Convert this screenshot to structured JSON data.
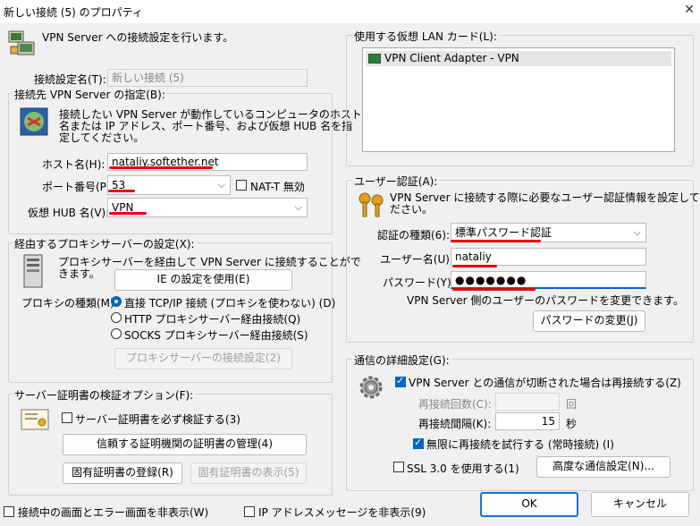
{
  "window": {
    "title": "新しい接続 (5) のプロパティ"
  },
  "header": {
    "text": "VPN Server への接続設定を行います。"
  },
  "connection_name": {
    "label": "接続設定名(T):",
    "value": "新しい接続 (5)"
  },
  "server_group": {
    "legend": "接続先 VPN Server の指定(B):",
    "desc": [
      "接続したい VPN Server が動作しているコンピュータのホスト",
      "名または IP アドレス、ポート番号、および仮想 HUB 名を指",
      "定してください。"
    ],
    "host_label": "ホスト名(H):",
    "host_value": "nataliy.softether.net",
    "port_label": "ポート番号(P):",
    "port_value": "53",
    "natt_label": "NAT-T 無効",
    "hub_label": "仮想 HUB 名(V):",
    "hub_value": "VPN"
  },
  "proxy_group": {
    "legend": "経由するプロキシサーバーの設定(X):",
    "desc": [
      "プロキシサーバーを経由して VPN Server に接続することがで",
      "きます。"
    ],
    "ie_button": "IE の設定を使用(E)",
    "type_label": "プロキシの種類(M):",
    "options": [
      "直接 TCP/IP 接続 (プロキシを使わない) (D)",
      "HTTP プロキシサーバー経由接続(Q)",
      "SOCKS プロキシサーバー経由接続(S)"
    ],
    "settings_button": "プロキシサーバーの接続設定(2)"
  },
  "cert_group": {
    "legend": "サーバー証明書の検証オプション(F):",
    "verify_label": "サーバー証明書を必ず検証する(3)",
    "trusted_button": "信頼する証明機関の証明書の管理(4)",
    "register_button": "固有証明書の登録(R)",
    "show_button": "固有証明書の表示(5)"
  },
  "lan_group": {
    "legend": "使用する仮想 LAN カード(L):",
    "items": [
      "VPN Client Adapter - VPN"
    ]
  },
  "auth_group": {
    "legend": "ユーザー認証(A):",
    "desc": [
      "VPN Server に接続する際に必要なユーザー認証情報を設定してく",
      "ださい。"
    ],
    "type_label": "認証の種類(6):",
    "type_value": "標準パスワード認証",
    "user_label": "ユーザー名(U):",
    "user_value": "nataliy",
    "pass_label": "パスワード(Y):",
    "pass_value": "●●●●●●●",
    "note": "VPN Server 側のユーザーのパスワードを変更できます。",
    "change_button": "パスワードの変更(J)"
  },
  "adv_group": {
    "legend": "通信の詳細設定(G):",
    "reconnect_label": "VPN Server との通信が切断された場合は再接続する(Z)",
    "retry_count_label": "再接続回数(C):",
    "retry_count_unit": "回",
    "interval_label": "再接続間隔(K):",
    "interval_value": "15",
    "interval_unit": "秒",
    "infinite_label": "無限に再接続を試行する (常時接続) (I)",
    "ssl3_label": "SSL 3.0 を使用する(1)",
    "advanced_button": "高度な通信設定(N)..."
  },
  "footer": {
    "hide_status_label": "接続中の画面とエラー画面を非表示(W)",
    "hide_ip_label": "IP アドレスメッセージを非表示(9)",
    "ok_button": "OK",
    "cancel_button": "キャンセル"
  },
  "colors": {
    "accent": "#0067c0",
    "annotation_red": "#e8000f",
    "default_button_border": "#1a6fd4"
  }
}
